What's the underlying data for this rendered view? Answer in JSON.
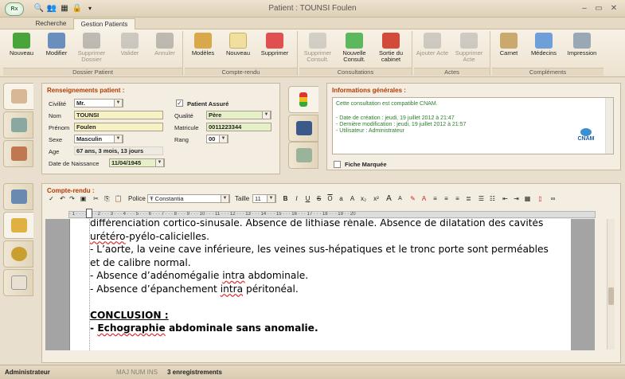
{
  "window": {
    "title": "Patient : TOUNSI  Foulen",
    "app_logo": "Rx"
  },
  "tabs": [
    "Recherche",
    "Gestion Patients"
  ],
  "ribbon": {
    "groups": {
      "dossier": "Dossier Patient",
      "compte_rendu": "Compte-rendu",
      "consultations": "Consultations",
      "actes": "Actes",
      "complements": "Compléments"
    },
    "buttons": {
      "nouveau": "Nouveau",
      "modifier": "Modifier",
      "supprimer_dossier": "Supprimer Dossier",
      "valider": "Valider",
      "annuler": "Annuler",
      "modeles": "Modèles",
      "nouveau_cr": "Nouveau",
      "supprimer_cr": "Supprimer",
      "supprimer_consult": "Supprimer Consult.",
      "nouvelle_consult": "Nouvelle Consult.",
      "sortie_cabinet": "Sortie du cabinet",
      "ajouter_acte": "Ajouter Acte",
      "supprimer_acte": "Supprimer Acte",
      "carnet": "Carnet",
      "medecins": "Médecins",
      "impression": "Impression"
    }
  },
  "patient": {
    "section_title": "Renseignements patient :",
    "civilite_label": "Civilité",
    "civilite": "Mr.",
    "nom_label": "Nom",
    "nom": "TOUNSI",
    "prenom_label": "Prénom",
    "prenom": "Foulen",
    "sexe_label": "Sexe",
    "sexe": "Masculin",
    "age_label": "Age",
    "age": "67 ans, 3 mois, 13 jours",
    "ddn_label": "Date de Naissance",
    "ddn": "11/04/1945",
    "assure_label": "Patient Assuré",
    "qualite_label": "Qualité",
    "qualite": "Père",
    "matricule_label": "Matricule",
    "matricule": "0011223344",
    "rang_label": "Rang",
    "rang": "00"
  },
  "infos": {
    "section_title": "Informations générales :",
    "compat": "Cette consultation est compatible CNAM.",
    "creation": "- Date de création : jeudi, 19 juillet 2012 à 21:47",
    "modification": "- Dernière modification : jeudi, 19 juillet 2012 à 21:57",
    "utilisateur": "- Utilisateur : Administrateur",
    "logo": "CNAM",
    "fiche_marquee": "Fiche Marquée"
  },
  "compte_rendu": {
    "section_title": "Compte-rendu :",
    "police_label": "Police",
    "police": "Constantia",
    "taille_label": "Taille",
    "taille": "11",
    "ruler": "· 1 · · · 1 · · · 2 · · · 3 · · · 4 · · · 5 · · · 6 · · · 7 · · · 8 · · · 9 · · · 10 · · · 11 · · · 12 · · · 13 · · · 14 · · · 15 · · · 16 · · · 17 · · · 18 · · · 19 · · 20",
    "lines": {
      "l1": "différenciation cortico-sinusale. Absence de lithiase rénale. Absence de dilatation des cavités",
      "l2a": "urétéro",
      "l2b": "-pyélo-calicielles.",
      "l3": "- L’aorte, la veine cave inférieure, les veines sus-hépatiques et le tronc porte sont perméables",
      "l4": "et de calibre normal.",
      "l5a": "- Absence d’adénomégalie ",
      "l5b": "intra",
      "l5c": " abdominale.",
      "l6a": "- Absence d’épanchement ",
      "l6b": "intra",
      "l6c": " péritonéal.",
      "conclusion": "CONCLUSION :",
      "c1a": "- ",
      "c1b": "Echographie",
      "c1c": " abdominale sans anomalie."
    }
  },
  "status": {
    "user": "Administrateur",
    "keys": "MAJ  NUM  INS",
    "records": "3 enregistrements"
  },
  "colors": {
    "accent_title": "#b23b00",
    "info_text": "#2e7d2e",
    "background": "#e9dfcf"
  }
}
